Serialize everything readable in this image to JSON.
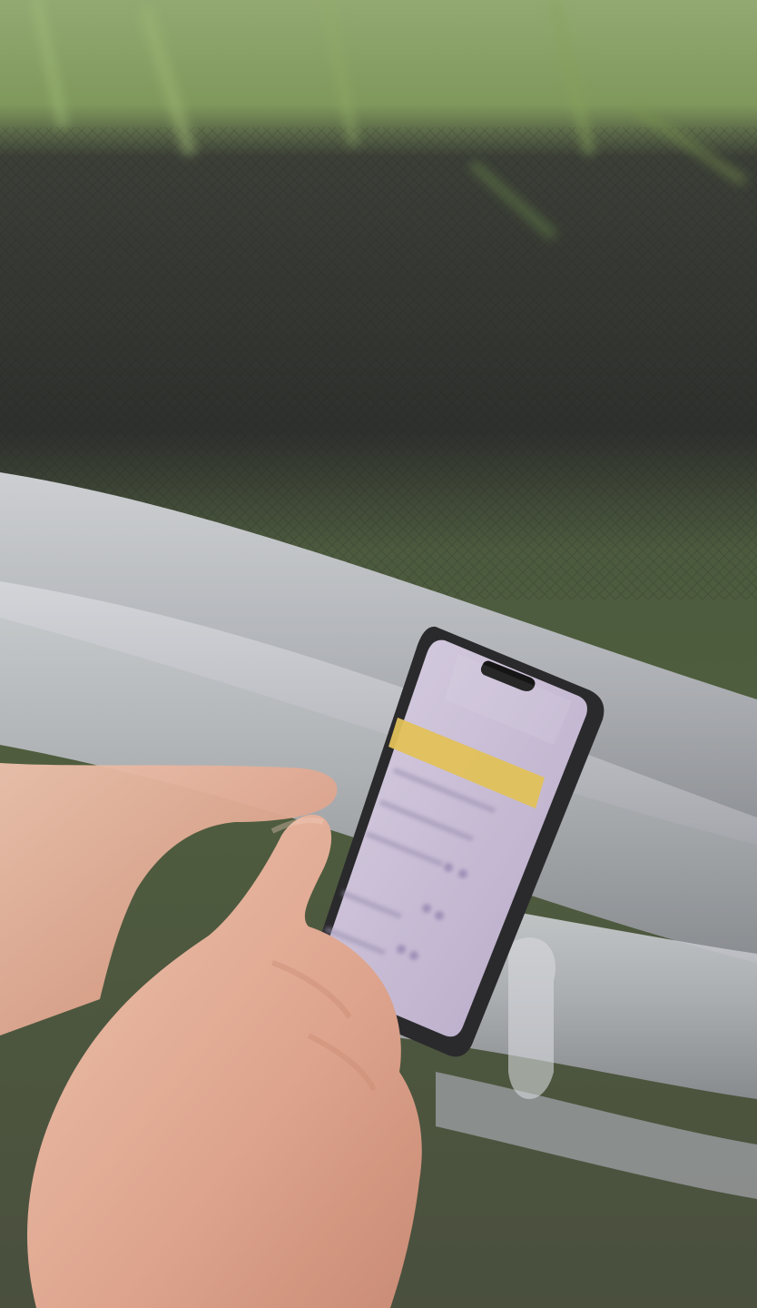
{
  "scene": {
    "colors": {
      "grass_top": "#8fa86a",
      "grass_mid": "#6e8a4c",
      "netting": "#2f302f",
      "ground": "#4a5a3a",
      "pipe_light": "#c9cbd0",
      "pipe_mid": "#a9abb1",
      "pipe_shadow": "#8c8e94",
      "phone_frame": "#2a2a2c",
      "phone_screen": "#c9bed6",
      "app_banner": "#e2c15a",
      "skin_light": "#e9b9a3",
      "skin_mid": "#d99d86",
      "skin_shadow": "#c38570"
    },
    "icons": [
      "phone-icon",
      "hand-icon"
    ]
  }
}
